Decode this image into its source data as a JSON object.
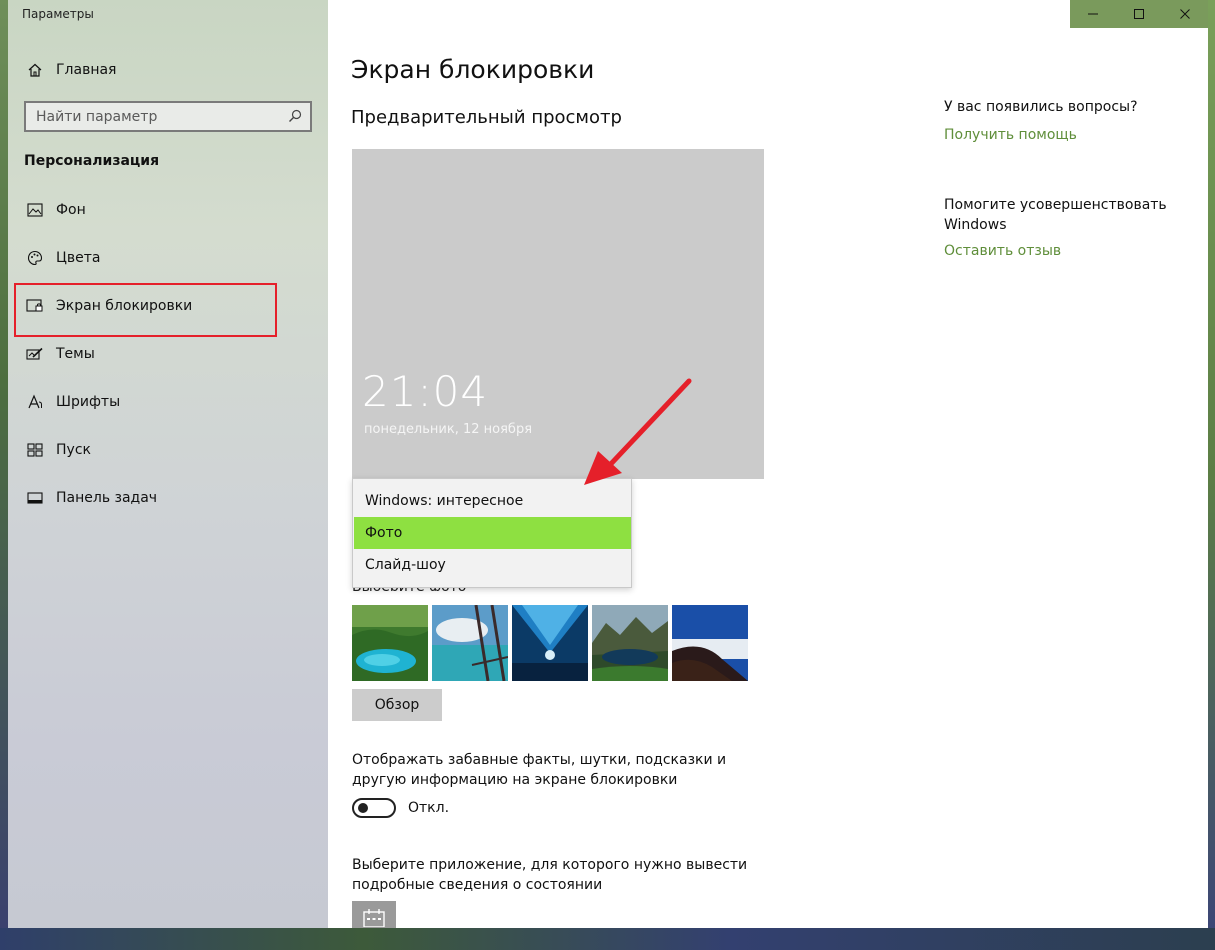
{
  "window": {
    "app_title": "Параметры",
    "controls": {
      "minimize": "—",
      "maximize": "☐",
      "close": "✕"
    },
    "titlebar_color": "#7a9a5c"
  },
  "sidebar": {
    "home_label": "Главная",
    "search_placeholder": "Найти параметр",
    "section_heading": "Персонализация",
    "items": [
      {
        "label": "Фон",
        "icon": "picture-icon"
      },
      {
        "label": "Цвета",
        "icon": "palette-icon"
      },
      {
        "label": "Экран блокировки",
        "icon": "lock-screen-icon",
        "highlighted": true
      },
      {
        "label": "Темы",
        "icon": "themes-icon"
      },
      {
        "label": "Шрифты",
        "icon": "fonts-icon"
      },
      {
        "label": "Пуск",
        "icon": "start-icon"
      },
      {
        "label": "Панель задач",
        "icon": "taskbar-icon"
      }
    ],
    "highlight_color": "#e5202a"
  },
  "main": {
    "page_title": "Экран блокировки",
    "preview_heading": "Предварительный просмотр",
    "preview": {
      "time": "21:04",
      "date": "понедельник, 12 ноября"
    },
    "background_dropdown": {
      "options": [
        "Windows: интересное",
        "Фото",
        "Слайд-шоу"
      ],
      "selected": "Фото",
      "selected_color": "#8ee041"
    },
    "choose_photo_label": "Выберите фото",
    "browse_button": "Обзор",
    "fun_facts_text": "Отображать забавные факты, шутки, подсказки и другую информацию на экране блокировки",
    "fun_facts_toggle": {
      "state": "Откл."
    },
    "status_app_text": "Выберите приложение, для которого нужно вывести подробные сведения о состоянии"
  },
  "right_panel": {
    "questions_heading": "У вас появились вопросы?",
    "get_help_link": "Получить помощь",
    "improve_heading": "Помогите усовершенствовать Windows",
    "feedback_link": "Оставить отзыв",
    "link_color": "#5f8e3a"
  },
  "annotation": {
    "arrow_color": "#e5202a"
  }
}
